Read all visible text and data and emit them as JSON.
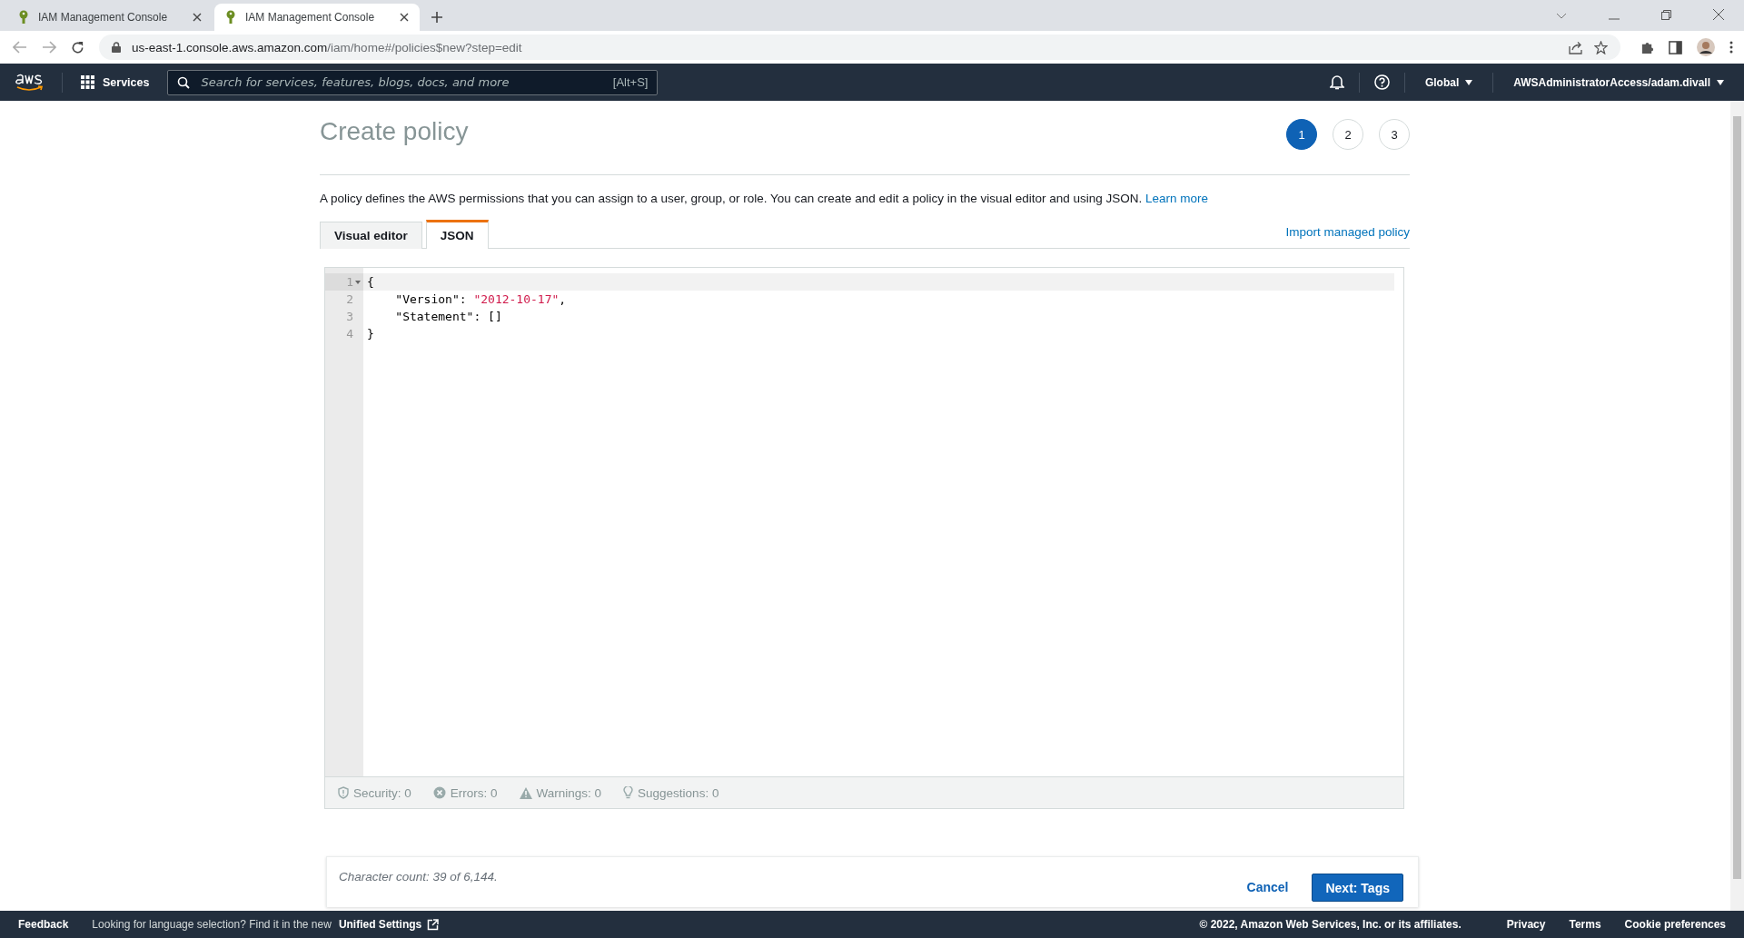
{
  "browser": {
    "tabs": [
      {
        "title": "IAM Management Console",
        "selected": false
      },
      {
        "title": "IAM Management Console",
        "selected": true
      }
    ],
    "url": {
      "host": "us-east-1.console.aws.amazon.com",
      "path": "/iam/home#/policies$new?step=edit"
    }
  },
  "navbar": {
    "services": "Services",
    "search": {
      "placeholder": "Search for services, features, blogs, docs, and more",
      "shortcut": "[Alt+S]"
    },
    "region": "Global",
    "account": "AWSAdministratorAccess/adam.divall"
  },
  "page": {
    "title": "Create policy",
    "steps": [
      {
        "label": "1",
        "selected": true
      },
      {
        "label": "2",
        "selected": false
      },
      {
        "label": "3",
        "selected": false
      }
    ],
    "description": "A policy defines the AWS permissions that you can assign to a user, group, or role. You can create and edit a policy in the visual editor and using JSON.",
    "learn_more": "Learn more",
    "tabs": [
      {
        "label": "Visual editor",
        "selected": false
      },
      {
        "label": "JSON",
        "selected": true
      }
    ],
    "import_link": "Import managed policy",
    "editor": {
      "lines": [
        {
          "number": "1",
          "active": true,
          "fold": true,
          "tokens": [
            {
              "kind": "punct",
              "text": "{"
            }
          ]
        },
        {
          "number": "2",
          "active": false,
          "fold": false,
          "tokens": [
            {
              "kind": "key",
              "text": "    \"Version\""
            },
            {
              "kind": "punct",
              "text": ": "
            },
            {
              "kind": "string",
              "text": "\"2012-10-17\""
            },
            {
              "kind": "punct",
              "text": ","
            }
          ]
        },
        {
          "number": "3",
          "active": false,
          "fold": false,
          "tokens": [
            {
              "kind": "key",
              "text": "    \"Statement\""
            },
            {
              "kind": "punct",
              "text": ": "
            },
            {
              "kind": "punct",
              "text": "[]"
            }
          ]
        },
        {
          "number": "4",
          "active": false,
          "fold": false,
          "tokens": [
            {
              "kind": "punct",
              "text": "}"
            }
          ]
        }
      ],
      "validation": [
        {
          "kind": "security",
          "text": "Security: 0"
        },
        {
          "kind": "errors",
          "text": "Errors: 0"
        },
        {
          "kind": "warnings",
          "text": "Warnings: 0"
        },
        {
          "kind": "suggestions",
          "text": "Suggestions: 0"
        }
      ]
    },
    "character_count": "Character count: 39 of 6,144.",
    "cancel": "Cancel",
    "next": "Next: Tags"
  },
  "footer": {
    "feedback": "Feedback",
    "language_note": "Looking for language selection? Find it in the new",
    "unified_settings": "Unified Settings",
    "copyright": "© 2022, Amazon Web Services, Inc. or its affiliates.",
    "links": [
      "Privacy",
      "Terms",
      "Cookie preferences"
    ]
  }
}
